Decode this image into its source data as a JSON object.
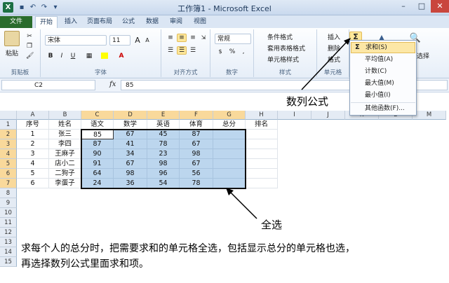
{
  "window": {
    "title": "工作簿1 - Microsoft Excel",
    "app_icon": "X",
    "controls": {
      "minimize": "–",
      "maximize": "□",
      "close": "✕"
    }
  },
  "ribbon_tabs": [
    "文件",
    "开始",
    "插入",
    "页面布局",
    "公式",
    "数据",
    "审阅",
    "视图"
  ],
  "active_tab": "开始",
  "ribbon": {
    "clipboard": {
      "paste": "粘贴",
      "label": "剪贴板"
    },
    "font": {
      "name": "宋体",
      "size": "11",
      "bold": "B",
      "italic": "I",
      "underline": "U",
      "grow": "A",
      "shrink": "A",
      "label": "字体"
    },
    "alignment": {
      "label": "对齐方式"
    },
    "number": {
      "format": "常规",
      "percent": "%",
      "comma": ",",
      "label": "数字"
    },
    "styles": {
      "conditional": "条件格式",
      "table": "套用表格格式",
      "cell": "单元格样式",
      "label": "样式"
    },
    "cells": {
      "insert": "插入",
      "delete": "删除",
      "format": "格式",
      "label": "单元格"
    },
    "editing": {
      "sum_icon": "Σ",
      "filter_select": "选择"
    }
  },
  "formula_bar": {
    "name_box": "C2",
    "fx": "fx",
    "value": "85"
  },
  "grid": {
    "columns": [
      "A",
      "B",
      "C",
      "D",
      "E",
      "F",
      "G",
      "H",
      "I",
      "J",
      "K",
      "L",
      "M"
    ],
    "rows": [
      "1",
      "2",
      "3",
      "4",
      "5",
      "6",
      "7",
      "8",
      "9",
      "10",
      "11",
      "12",
      "13",
      "14",
      "15"
    ],
    "table": [
      [
        "序号",
        "姓名",
        "语文",
        "数学",
        "英语",
        "体育",
        "总分",
        "排名"
      ],
      [
        "1",
        "张三",
        "85",
        "67",
        "45",
        "87",
        "",
        ""
      ],
      [
        "2",
        "李四",
        "87",
        "41",
        "78",
        "67",
        "",
        ""
      ],
      [
        "3",
        "王麻子",
        "90",
        "34",
        "23",
        "98",
        "",
        ""
      ],
      [
        "4",
        "店小二",
        "91",
        "67",
        "98",
        "67",
        "",
        ""
      ],
      [
        "5",
        "二狗子",
        "64",
        "98",
        "96",
        "56",
        "",
        ""
      ],
      [
        "6",
        "李蛋子",
        "24",
        "36",
        "54",
        "78",
        "",
        ""
      ]
    ]
  },
  "autosum_menu": {
    "items": [
      "求和(S)",
      "平均值(A)",
      "计数(C)",
      "最大值(M)",
      "最小值(I)",
      "其他函数(F)..."
    ],
    "highlighted": "求和(S)"
  },
  "annotations": {
    "label_formula": "数列公式",
    "label_select_all": "全选",
    "note_line1": "求每个人的总分时，把需要求和的单元格全选，包括显示总分的单元格也选，",
    "note_line2": "再选择数列公式里面求和项。"
  },
  "colors": {
    "selection": "#bcd6ee",
    "header_highlight": "#f9d99b",
    "file_tab": "#2a6c2c",
    "menu_highlight": "#fce7a6"
  }
}
